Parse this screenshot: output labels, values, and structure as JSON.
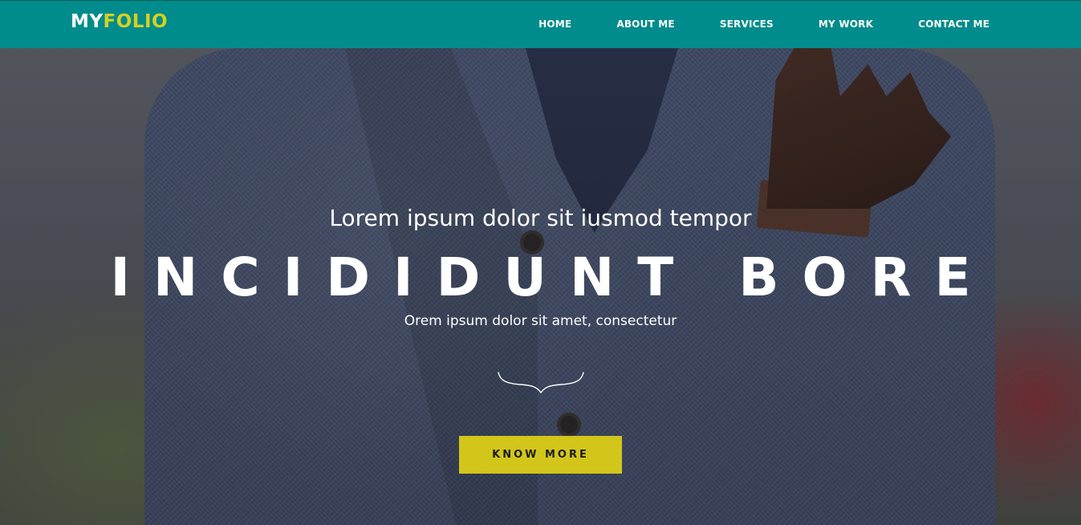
{
  "brand": {
    "logo_part1": "MY",
    "logo_part2": "FOLIO",
    "primary_color": "#008c8c",
    "accent_color": "#d6d11e"
  },
  "nav": {
    "items": [
      {
        "label": "HOME"
      },
      {
        "label": "ABOUT ME"
      },
      {
        "label": "SERVICES"
      },
      {
        "label": "MY WORK"
      },
      {
        "label": "CONTACT ME"
      }
    ]
  },
  "hero": {
    "subtitle": "Lorem ipsum dolor sit iusmod tempor",
    "title": "INCIDIDUNT BORE",
    "tagline": "Orem ipsum dolor sit amet, consectetur",
    "divider_icon": "curly-brace-divider-icon",
    "cta_label": "KNOW MORE",
    "cta_color": "#d2c61a"
  }
}
